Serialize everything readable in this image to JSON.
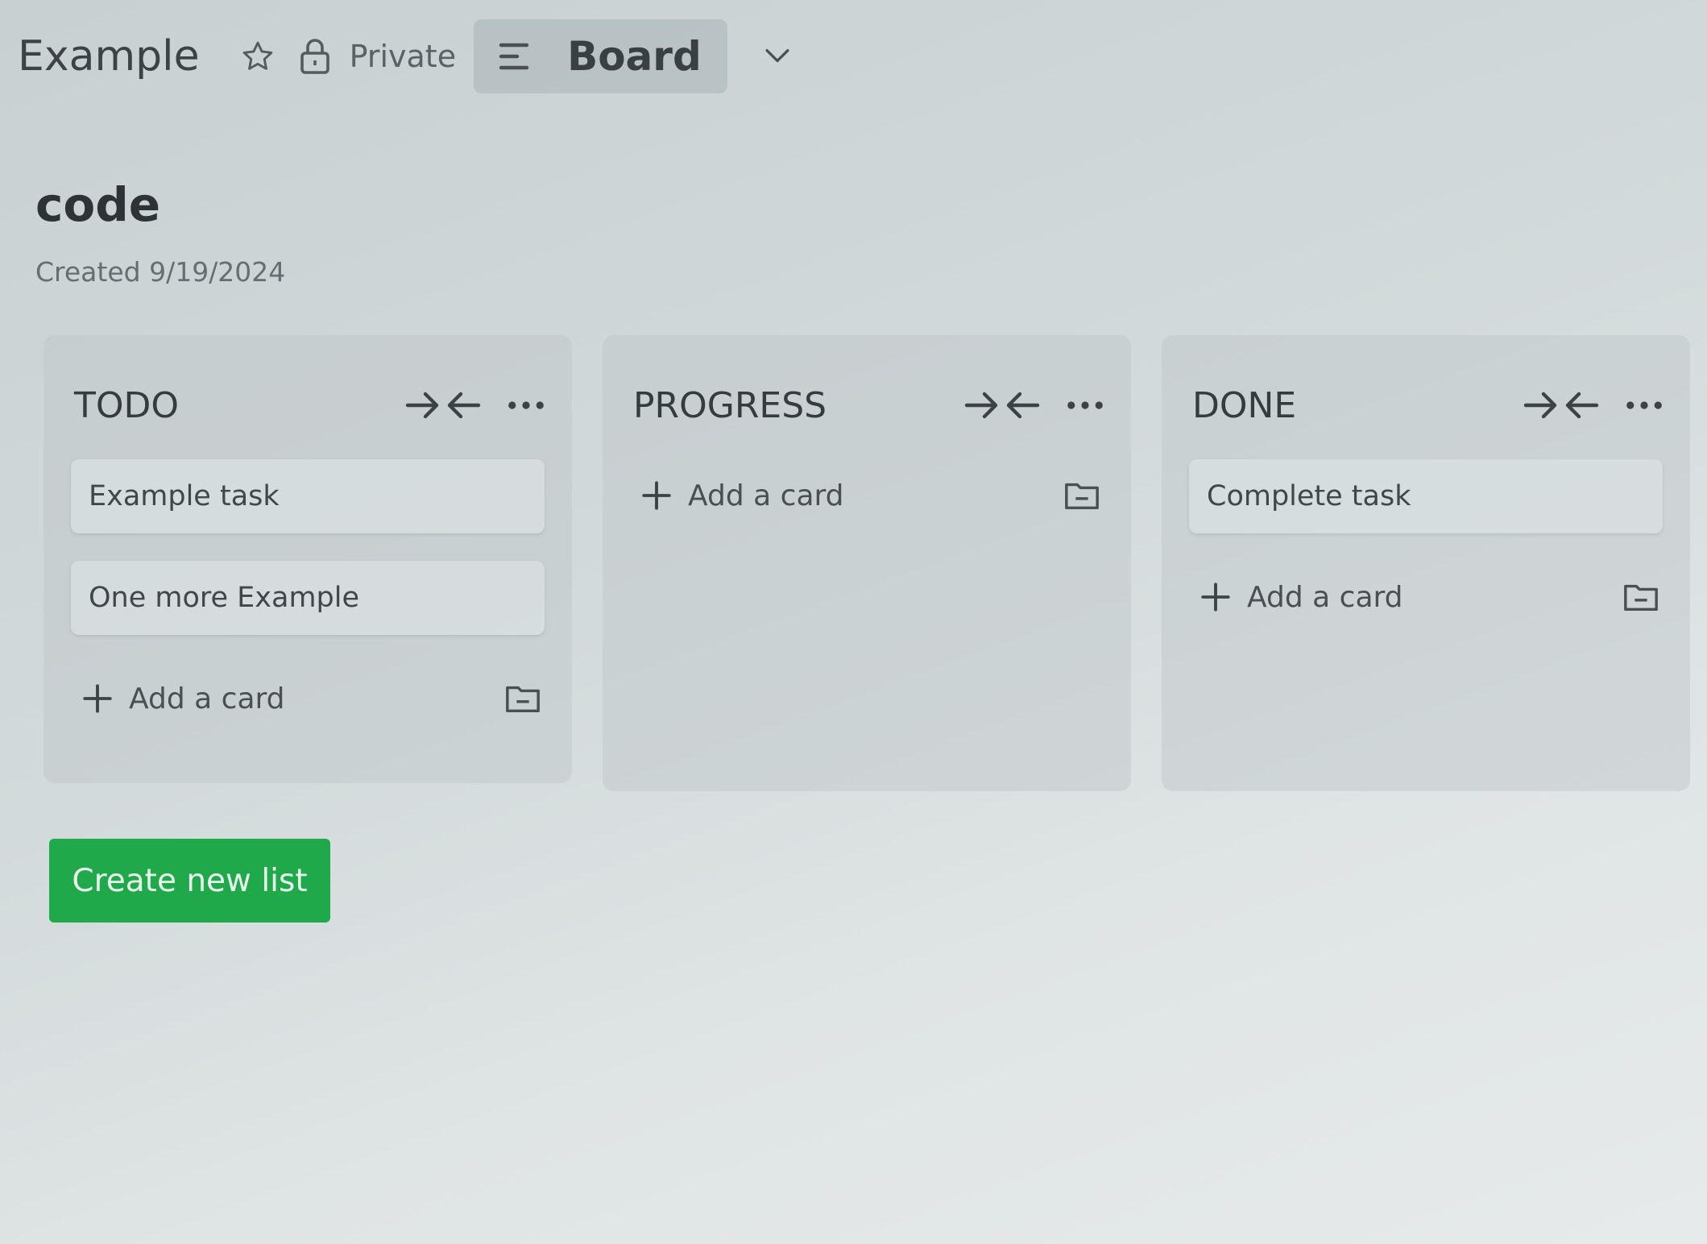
{
  "topbar": {
    "board_name": "Example",
    "star_icon": "star-icon",
    "lock_icon": "lock-icon",
    "visibility": "Private",
    "view_icon": "list-lines-icon",
    "view_label": "Board",
    "view_menu_icon": "chevron-down-icon"
  },
  "header": {
    "title": "code",
    "created": "Created 9/19/2024"
  },
  "lists": [
    {
      "title": "TODO",
      "cards": [
        "Example task",
        "One more Example"
      ],
      "add_card_label": "Add a card"
    },
    {
      "title": "PROGRESS",
      "cards": [],
      "add_card_label": "Add a card"
    },
    {
      "title": "DONE",
      "cards": [
        "Complete task"
      ],
      "add_card_label": "Add a card"
    }
  ],
  "list_icons": {
    "collapse": "collapse-arrows-icon",
    "more": "more-dots-icon",
    "add": "plus-icon",
    "template": "card-template-icon"
  },
  "create_list_label": "Create new list",
  "colors": {
    "accent_green": "#1fa94a",
    "background": "#d3dadb"
  }
}
